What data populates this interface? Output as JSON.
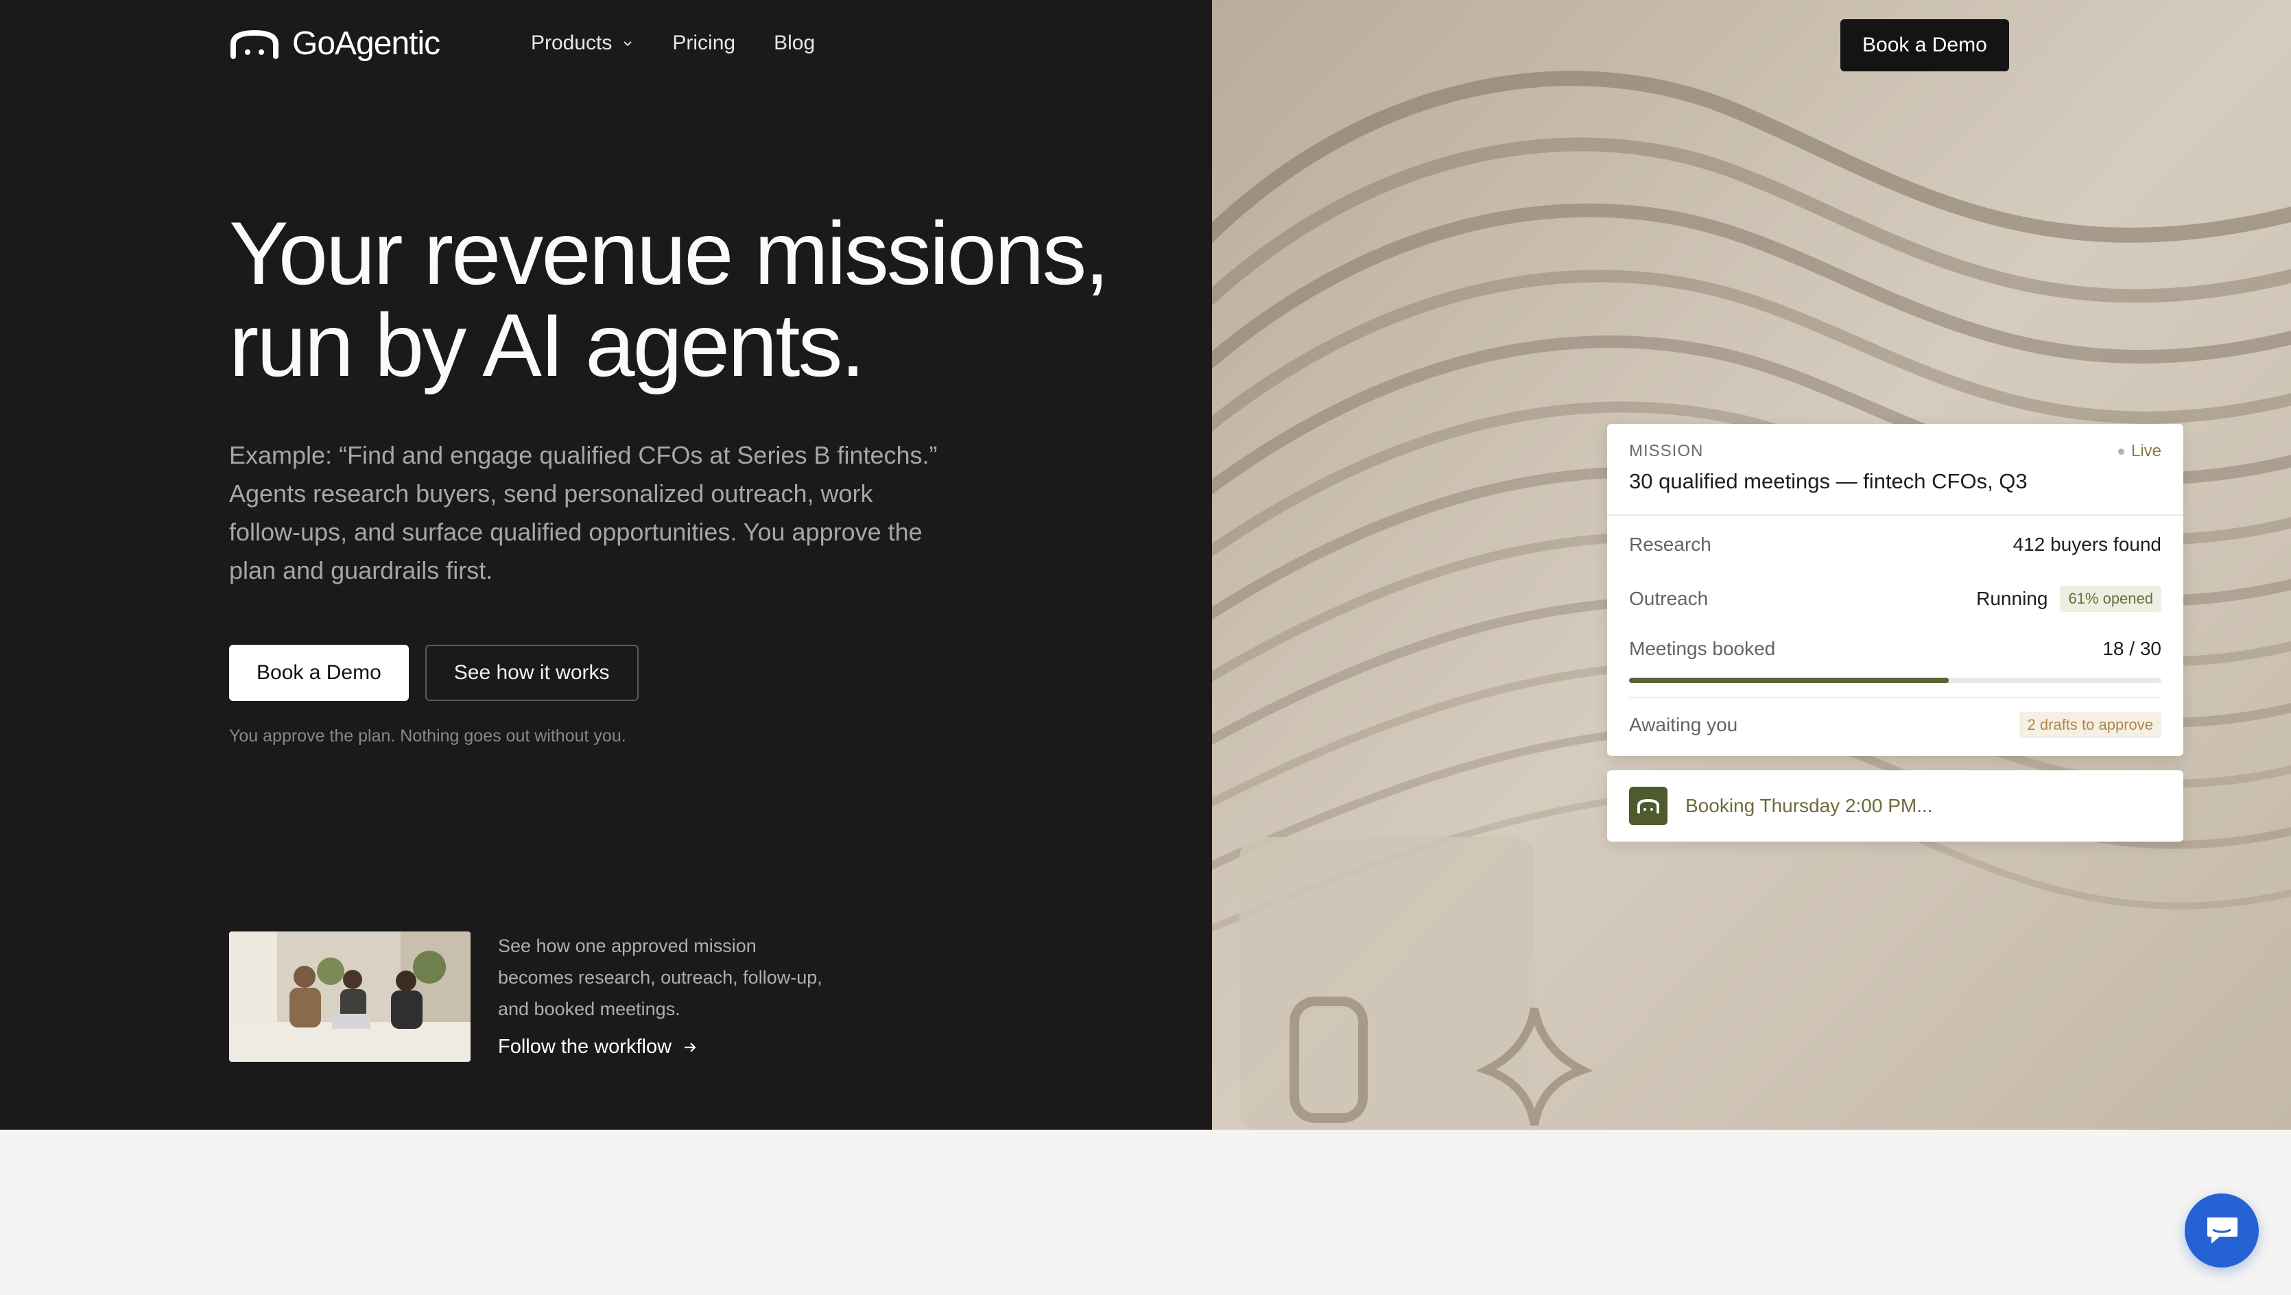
{
  "brand": {
    "name": "GoAgentic"
  },
  "nav": {
    "products": "Products",
    "pricing": "Pricing",
    "blog": "Blog"
  },
  "header_cta": "Book a Demo",
  "hero": {
    "headline_line1": "Your revenue missions,",
    "headline_line2": "run by AI agents.",
    "lede": "Example: “Find and engage qualified CFOs at Series B fintechs.” Agents research buyers, send personalized outreach, work follow-ups, and surface qualified opportunities. You approve the plan and guardrails first.",
    "primary_cta": "Book a Demo",
    "secondary_cta": "See how it works",
    "fine_print": "You approve the plan. Nothing goes out without you."
  },
  "feature": {
    "copy": "See how one approved mission becomes research, outreach, follow-up, and booked meetings.",
    "link": "Follow the workflow"
  },
  "mission_card": {
    "eyebrow": "MISSION",
    "status": "Live",
    "title": "30 qualified meetings — fintech CFOs, Q3",
    "rows": [
      {
        "label": "Research",
        "value": "412 buyers found"
      },
      {
        "label": "Outreach",
        "value": "Running",
        "badge": "61% opened"
      },
      {
        "label": "Meetings booked",
        "value": "18 / 30",
        "progress": 0.6
      },
      {
        "label": "Awaiting you",
        "badge": "2 drafts to approve"
      }
    ]
  },
  "status_card": {
    "text": "Booking Thursday 2:00 PM..."
  },
  "colors": {
    "dark_bg": "#1b1a1a",
    "accent_olive": "#5a6332",
    "chat_blue": "#2563d4",
    "page_bg": "#f5f4f2"
  },
  "icons": [
    "agent-logo-icon",
    "chevron-down-icon",
    "arrow-right-icon",
    "chat-icon"
  ]
}
